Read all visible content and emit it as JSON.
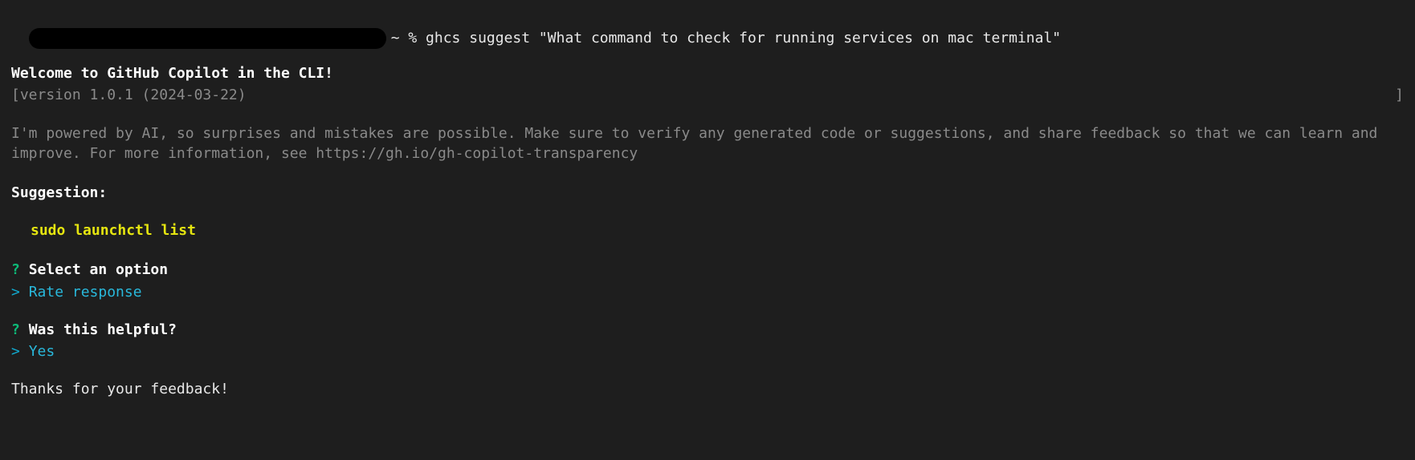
{
  "prompt": {
    "symbol": "~ %",
    "command": "ghcs suggest \"What command to check for running services on mac terminal\""
  },
  "welcome": "Welcome to GitHub Copilot in the CLI!",
  "version": "[version 1.0.1 (2024-03-22)",
  "version_close": "]",
  "disclaimer": "I'm powered by AI, so surprises and mistakes are possible. Make sure to verify any generated code or suggestions, and share feedback so that we can learn and improve. For more information, see https://gh.io/gh-copilot-transparency",
  "suggestion_label": "Suggestion:",
  "suggestion_command": "sudo launchctl list",
  "select_option": {
    "marker": "?",
    "label": "Select an option",
    "caret": ">",
    "choice": "Rate response"
  },
  "helpful": {
    "marker": "?",
    "label": "Was this helpful?",
    "caret": ">",
    "choice": "Yes"
  },
  "thanks": "Thanks for your feedback!"
}
